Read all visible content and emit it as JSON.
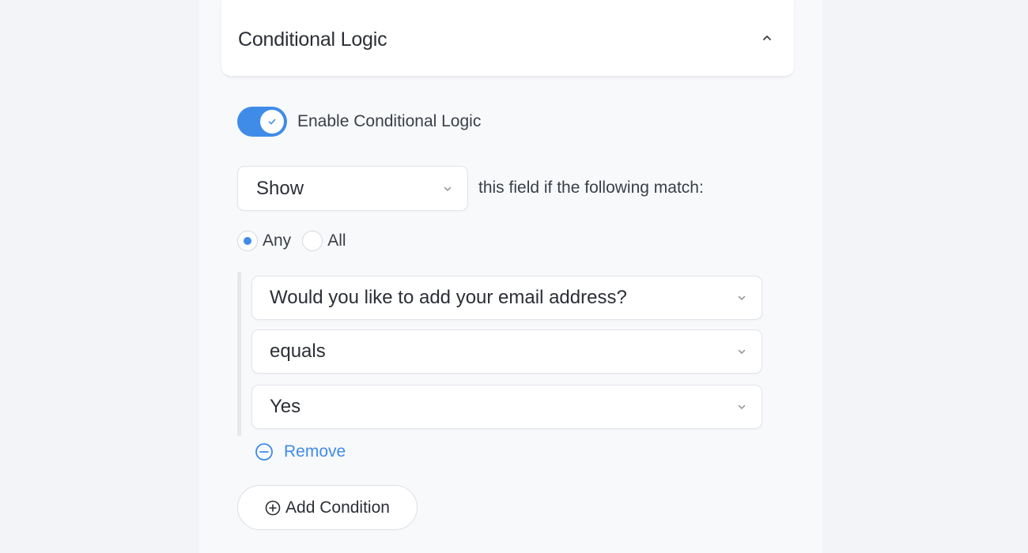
{
  "header": {
    "title": "Conditional Logic",
    "collapse_icon": "chevron-up-icon"
  },
  "toggle": {
    "label": "Enable Conditional Logic",
    "enabled": true,
    "color": "#3f8ce8"
  },
  "action": {
    "selected": "Show",
    "suffix": "this field if the following match:"
  },
  "match_mode": {
    "options": [
      {
        "label": "Any",
        "selected": true
      },
      {
        "label": "All",
        "selected": false
      }
    ]
  },
  "condition": {
    "field": "Would you like to add your email address?",
    "operator": "equals",
    "value": "Yes",
    "remove_label": "Remove"
  },
  "add_condition": {
    "label": "Add Condition"
  },
  "colors": {
    "accent": "#3f8ce8",
    "text": "#2b2f36",
    "border": "#e1e4e9"
  }
}
